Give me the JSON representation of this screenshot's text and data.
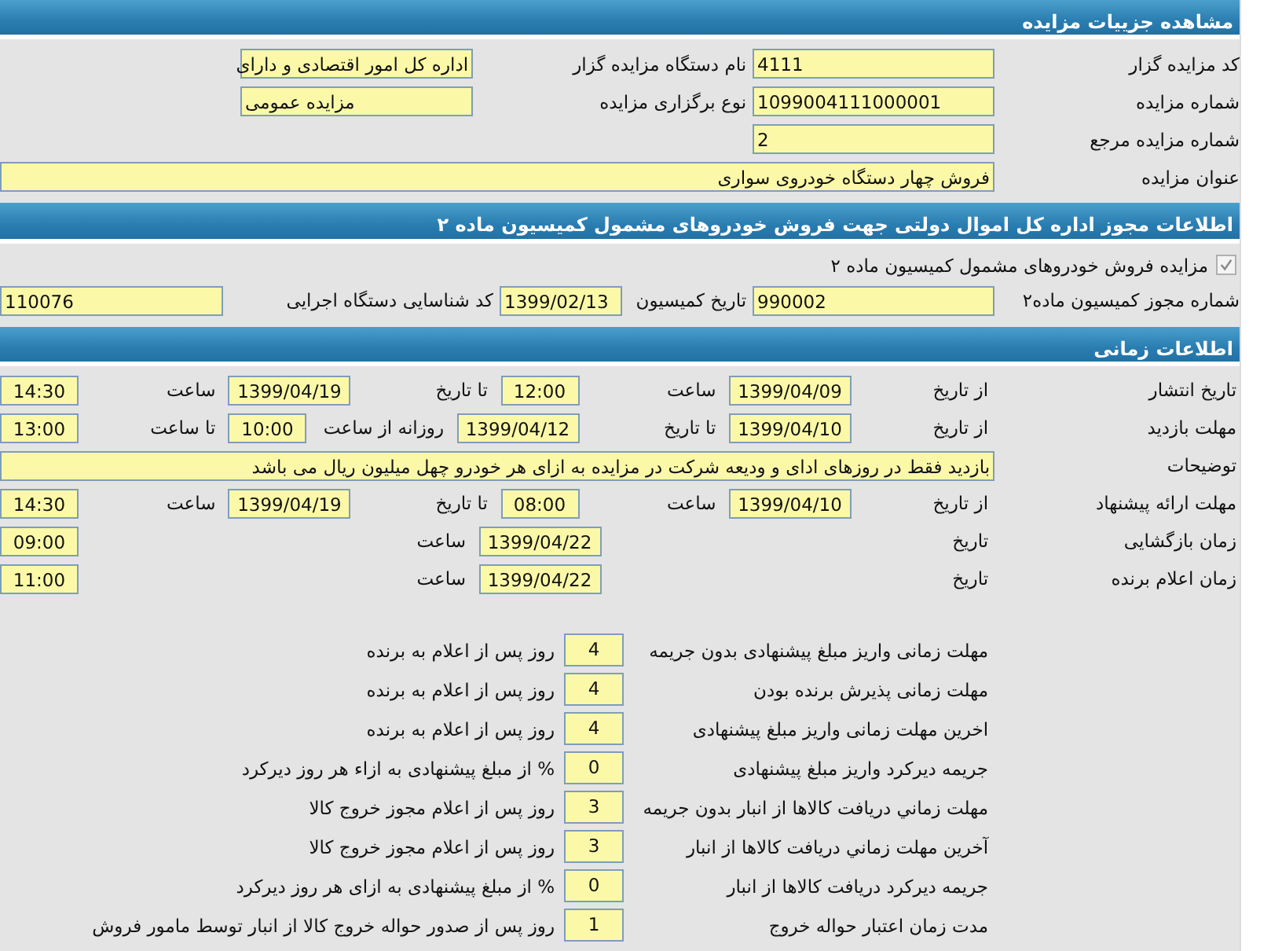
{
  "sections": [
    {
      "title": "مشاهده جزییات مزایده",
      "kind": "auction",
      "rows": [
        {
          "cells": [
            {
              "kind": "label",
              "text": "کد مزایده گزار"
            },
            {
              "kind": "field",
              "value": "4111"
            },
            {
              "kind": "label",
              "text": "نام دستگاه مزایده گزار"
            },
            {
              "kind": "field",
              "value": "اداره کل امور اقتصادی و دارای"
            }
          ]
        },
        {
          "cells": [
            {
              "kind": "label",
              "text": "شماره مزایده"
            },
            {
              "kind": "field",
              "value": "1099004111000001"
            },
            {
              "kind": "label",
              "text": "نوع برگزاری مزایده"
            },
            {
              "kind": "field",
              "value": "مزایده عمومی"
            }
          ]
        },
        {
          "cells": [
            {
              "kind": "label",
              "text": "شماره مزایده مرجع"
            },
            {
              "kind": "field",
              "value": "2"
            }
          ]
        },
        {
          "cells": [
            {
              "kind": "label",
              "text": "عنوان مزایده"
            },
            {
              "kind": "wide",
              "value": "فروش چهار دستگاه خودروی سواری"
            }
          ]
        }
      ]
    },
    {
      "title": "اطلاعات مجوز اداره کل اموال دولتی جهت فروش خودروهای مشمول کمیسیون ماده ۲",
      "kind": "license",
      "checkbox": {
        "label": "مزایده فروش خودروهای مشمول کمیسیون ماده ۲",
        "checked": true
      },
      "rows": [
        {
          "cells": [
            {
              "kind": "label",
              "text": "شماره مجوز کمیسیون ماده۲"
            },
            {
              "kind": "field",
              "value": "990002"
            },
            {
              "kind": "label",
              "text": "تاریخ کمیسیون"
            },
            {
              "kind": "date",
              "value": "1399/02/13"
            },
            {
              "kind": "label",
              "text": "کد شناسایی دستگاه اجرایی"
            },
            {
              "kind": "field",
              "value": "110076"
            }
          ]
        }
      ]
    },
    {
      "title": "اطلاعات زمانی",
      "kind": "time",
      "rows": [
        {
          "cells": [
            {
              "kind": "label",
              "text": "تاریخ انتشار"
            },
            {
              "kind": "text",
              "text": "از تاریخ"
            },
            {
              "kind": "date",
              "value": "1399/04/09"
            },
            {
              "kind": "text",
              "text": "ساعت"
            },
            {
              "kind": "time",
              "value": "12:00"
            },
            {
              "kind": "text",
              "text": "تا تاریخ"
            },
            {
              "kind": "date",
              "value": "1399/04/19"
            },
            {
              "kind": "text",
              "text": "ساعت"
            },
            {
              "kind": "time",
              "value": "14:30"
            }
          ]
        },
        {
          "cells": [
            {
              "kind": "label",
              "text": "مهلت بازدید"
            },
            {
              "kind": "text",
              "text": "از تاریخ"
            },
            {
              "kind": "date",
              "value": "1399/04/10"
            },
            {
              "kind": "text",
              "text": "تا تاریخ"
            },
            {
              "kind": "date",
              "value": "1399/04/12"
            },
            {
              "kind": "text",
              "text": "روزانه از ساعت"
            },
            {
              "kind": "time",
              "value": "10:00"
            },
            {
              "kind": "text",
              "text": "تا ساعت"
            },
            {
              "kind": "time",
              "value": "13:00"
            }
          ]
        },
        {
          "cells": [
            {
              "kind": "label",
              "text": "توضیحات"
            },
            {
              "kind": "wide",
              "value": "بازدید فقط در روزهای ادای و ودیعه شرکت در مزایده به ازای هر خودرو چهل میلیون ریال می باشد"
            }
          ]
        },
        {
          "cells": [
            {
              "kind": "label",
              "text": "مهلت ارائه پیشنهاد"
            },
            {
              "kind": "text",
              "text": "از تاریخ"
            },
            {
              "kind": "date",
              "value": "1399/04/10"
            },
            {
              "kind": "text",
              "text": "ساعت"
            },
            {
              "kind": "time",
              "value": "08:00"
            },
            {
              "kind": "text",
              "text": "تا تاریخ"
            },
            {
              "kind": "date",
              "value": "1399/04/19"
            },
            {
              "kind": "text",
              "text": "ساعت"
            },
            {
              "kind": "time",
              "value": "14:30"
            }
          ]
        },
        {
          "cells": [
            {
              "kind": "label",
              "text": "زمان بازگشایی"
            },
            {
              "kind": "text",
              "text": "تاریخ"
            },
            {
              "kind": "date",
              "value": "1399/04/22"
            },
            {
              "kind": "text",
              "text": "ساعت"
            },
            {
              "kind": "time",
              "value": "09:00"
            }
          ]
        },
        {
          "cells": [
            {
              "kind": "label",
              "text": "زمان اعلام برنده"
            },
            {
              "kind": "text",
              "text": "تاریخ"
            },
            {
              "kind": "date",
              "value": "1399/04/22"
            },
            {
              "kind": "text",
              "text": "ساعت"
            },
            {
              "kind": "time",
              "value": "11:00"
            }
          ]
        }
      ],
      "terms": [
        {
          "label": "مهلت زمانی واریز مبلغ پیشنهادی بدون جریمه",
          "value": "4",
          "suffix": "روز پس از اعلام به برنده"
        },
        {
          "label": "مهلت زمانی پذیرش برنده بودن",
          "value": "4",
          "suffix": "روز پس از اعلام به برنده"
        },
        {
          "label": "اخرین مهلت زمانی واریز مبلغ پیشنهادی",
          "value": "4",
          "suffix": "روز پس از اعلام به برنده"
        },
        {
          "label": "جریمه دیرکرد واریز مبلغ پیشنهادی",
          "value": "0",
          "suffix": "% از مبلغ پیشنهادی به ازاء هر روز دیرکرد"
        },
        {
          "label": "مهلت زماني دريافت کالاها از انبار بدون جریمه",
          "value": "3",
          "suffix": "روز پس از اعلام مجوز خروج کالا"
        },
        {
          "label": "آخرین مهلت زماني دريافت کالاها از انبار",
          "value": "3",
          "suffix": "روز پس از اعلام مجوز خروج کالا"
        },
        {
          "label": "جریمه دیرکرد دریافت کالاها از انبار",
          "value": "0",
          "suffix": "% از مبلغ پیشنهادی به ازای هر روز دیرکرد"
        },
        {
          "label": "مدت زمان اعتبار حواله خروج",
          "value": "1",
          "suffix": "روز پس از صدور حواله خروج کالا از انبار توسط مامور فروش"
        }
      ]
    }
  ]
}
